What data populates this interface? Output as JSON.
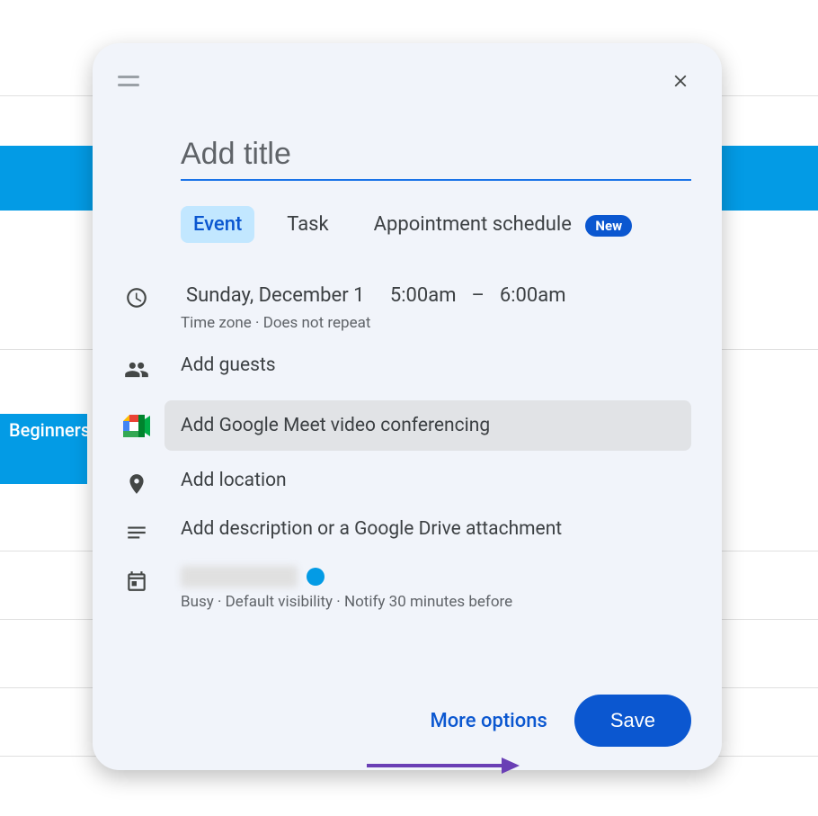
{
  "background": {
    "event_text": "Beginners T"
  },
  "modal": {
    "title_placeholder": "Add title",
    "tabs": {
      "event": "Event",
      "task": "Task",
      "appointment": "Appointment schedule",
      "new_badge": "New"
    },
    "datetime": {
      "date": "Sunday, December 1",
      "start": "5:00am",
      "dash": "–",
      "end": "6:00am",
      "sub": "Time zone · Does not repeat"
    },
    "guests": "Add guests",
    "meet": "Add Google Meet video conferencing",
    "location": "Add location",
    "description": "Add description or a Google Drive attachment",
    "calendar_sub": "Busy · Default visibility · Notify 30 minutes before",
    "more_options": "More options",
    "save": "Save"
  }
}
